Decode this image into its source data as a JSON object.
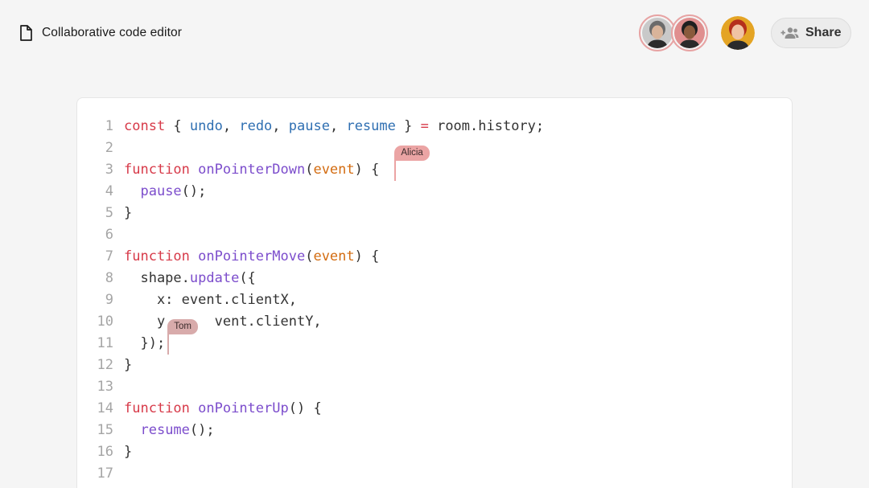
{
  "header": {
    "doc_title": "Collaborative code editor",
    "share_label": "Share",
    "icons": {
      "doc": "document-icon",
      "share": "add-people-icon"
    }
  },
  "avatars": [
    {
      "name": "avatar-user-1",
      "ring_color": "#e7a3a3",
      "skin": "#d9b49a",
      "hair": "#6b6b6b",
      "bg": "#c9c9c9"
    },
    {
      "name": "avatar-user-2",
      "ring_color": "#e7a3a3",
      "skin": "#8a5a3c",
      "hair": "#1f1f1f",
      "bg": "#e08f8f"
    },
    {
      "name": "avatar-user-3",
      "ring_color": "",
      "skin": "#f0c3a3",
      "hair": "#b5301c",
      "bg": "#e4a424"
    }
  ],
  "editor": {
    "language": "javascript",
    "colors": {
      "keyword": "#d73a49",
      "variable": "#2f6fb2",
      "function": "#7c4dcc",
      "parameter": "#d36c11",
      "plain": "#333333",
      "line_number": "#a5a5a5"
    },
    "lines": [
      {
        "n": "1",
        "tokens": [
          [
            "kw",
            "const"
          ],
          [
            "plain",
            " { "
          ],
          [
            "var",
            "undo"
          ],
          [
            "plain",
            ", "
          ],
          [
            "var",
            "redo"
          ],
          [
            "plain",
            ", "
          ],
          [
            "var",
            "pause"
          ],
          [
            "plain",
            ", "
          ],
          [
            "var",
            "resume"
          ],
          [
            "plain",
            " } "
          ],
          [
            "op",
            "="
          ],
          [
            "plain",
            " room.history;"
          ]
        ]
      },
      {
        "n": "2",
        "tokens": []
      },
      {
        "n": "3",
        "tokens": [
          [
            "kw",
            "function"
          ],
          [
            "plain",
            " "
          ],
          [
            "fn",
            "onPointerDown"
          ],
          [
            "plain",
            "("
          ],
          [
            "param",
            "event"
          ],
          [
            "plain",
            ") {"
          ]
        ]
      },
      {
        "n": "4",
        "tokens": [
          [
            "plain",
            "  "
          ],
          [
            "fn",
            "pause"
          ],
          [
            "plain",
            "();"
          ]
        ]
      },
      {
        "n": "5",
        "tokens": [
          [
            "plain",
            "}"
          ]
        ]
      },
      {
        "n": "6",
        "tokens": []
      },
      {
        "n": "7",
        "tokens": [
          [
            "kw",
            "function"
          ],
          [
            "plain",
            " "
          ],
          [
            "fn",
            "onPointerMove"
          ],
          [
            "plain",
            "("
          ],
          [
            "param",
            "event"
          ],
          [
            "plain",
            ") {"
          ]
        ]
      },
      {
        "n": "8",
        "tokens": [
          [
            "plain",
            "  shape."
          ],
          [
            "fn",
            "update"
          ],
          [
            "plain",
            "({"
          ]
        ]
      },
      {
        "n": "9",
        "tokens": [
          [
            "plain",
            "    x: event.clientX,"
          ]
        ]
      },
      {
        "n": "10",
        "tokens": [
          [
            "plain",
            "    y"
          ],
          [
            "plain",
            "      "
          ],
          [
            "plain",
            "vent.clientY,"
          ]
        ]
      },
      {
        "n": "11",
        "tokens": [
          [
            "plain",
            "  });"
          ]
        ]
      },
      {
        "n": "12",
        "tokens": [
          [
            "plain",
            "}"
          ]
        ]
      },
      {
        "n": "13",
        "tokens": []
      },
      {
        "n": "14",
        "tokens": [
          [
            "kw",
            "function"
          ],
          [
            "plain",
            " "
          ],
          [
            "fn",
            "onPointerUp"
          ],
          [
            "plain",
            "() {"
          ]
        ]
      },
      {
        "n": "15",
        "tokens": [
          [
            "plain",
            "  "
          ],
          [
            "fn",
            "resume"
          ],
          [
            "plain",
            "();"
          ]
        ]
      },
      {
        "n": "16",
        "tokens": [
          [
            "plain",
            "}"
          ]
        ]
      },
      {
        "n": "17",
        "tokens": []
      }
    ],
    "cursors": [
      {
        "name": "Alicia",
        "line": 3,
        "column": 31,
        "color": "#eba4a4"
      },
      {
        "name": "Tom",
        "line": 11,
        "column": 5,
        "color": "#d8abab"
      }
    ]
  }
}
